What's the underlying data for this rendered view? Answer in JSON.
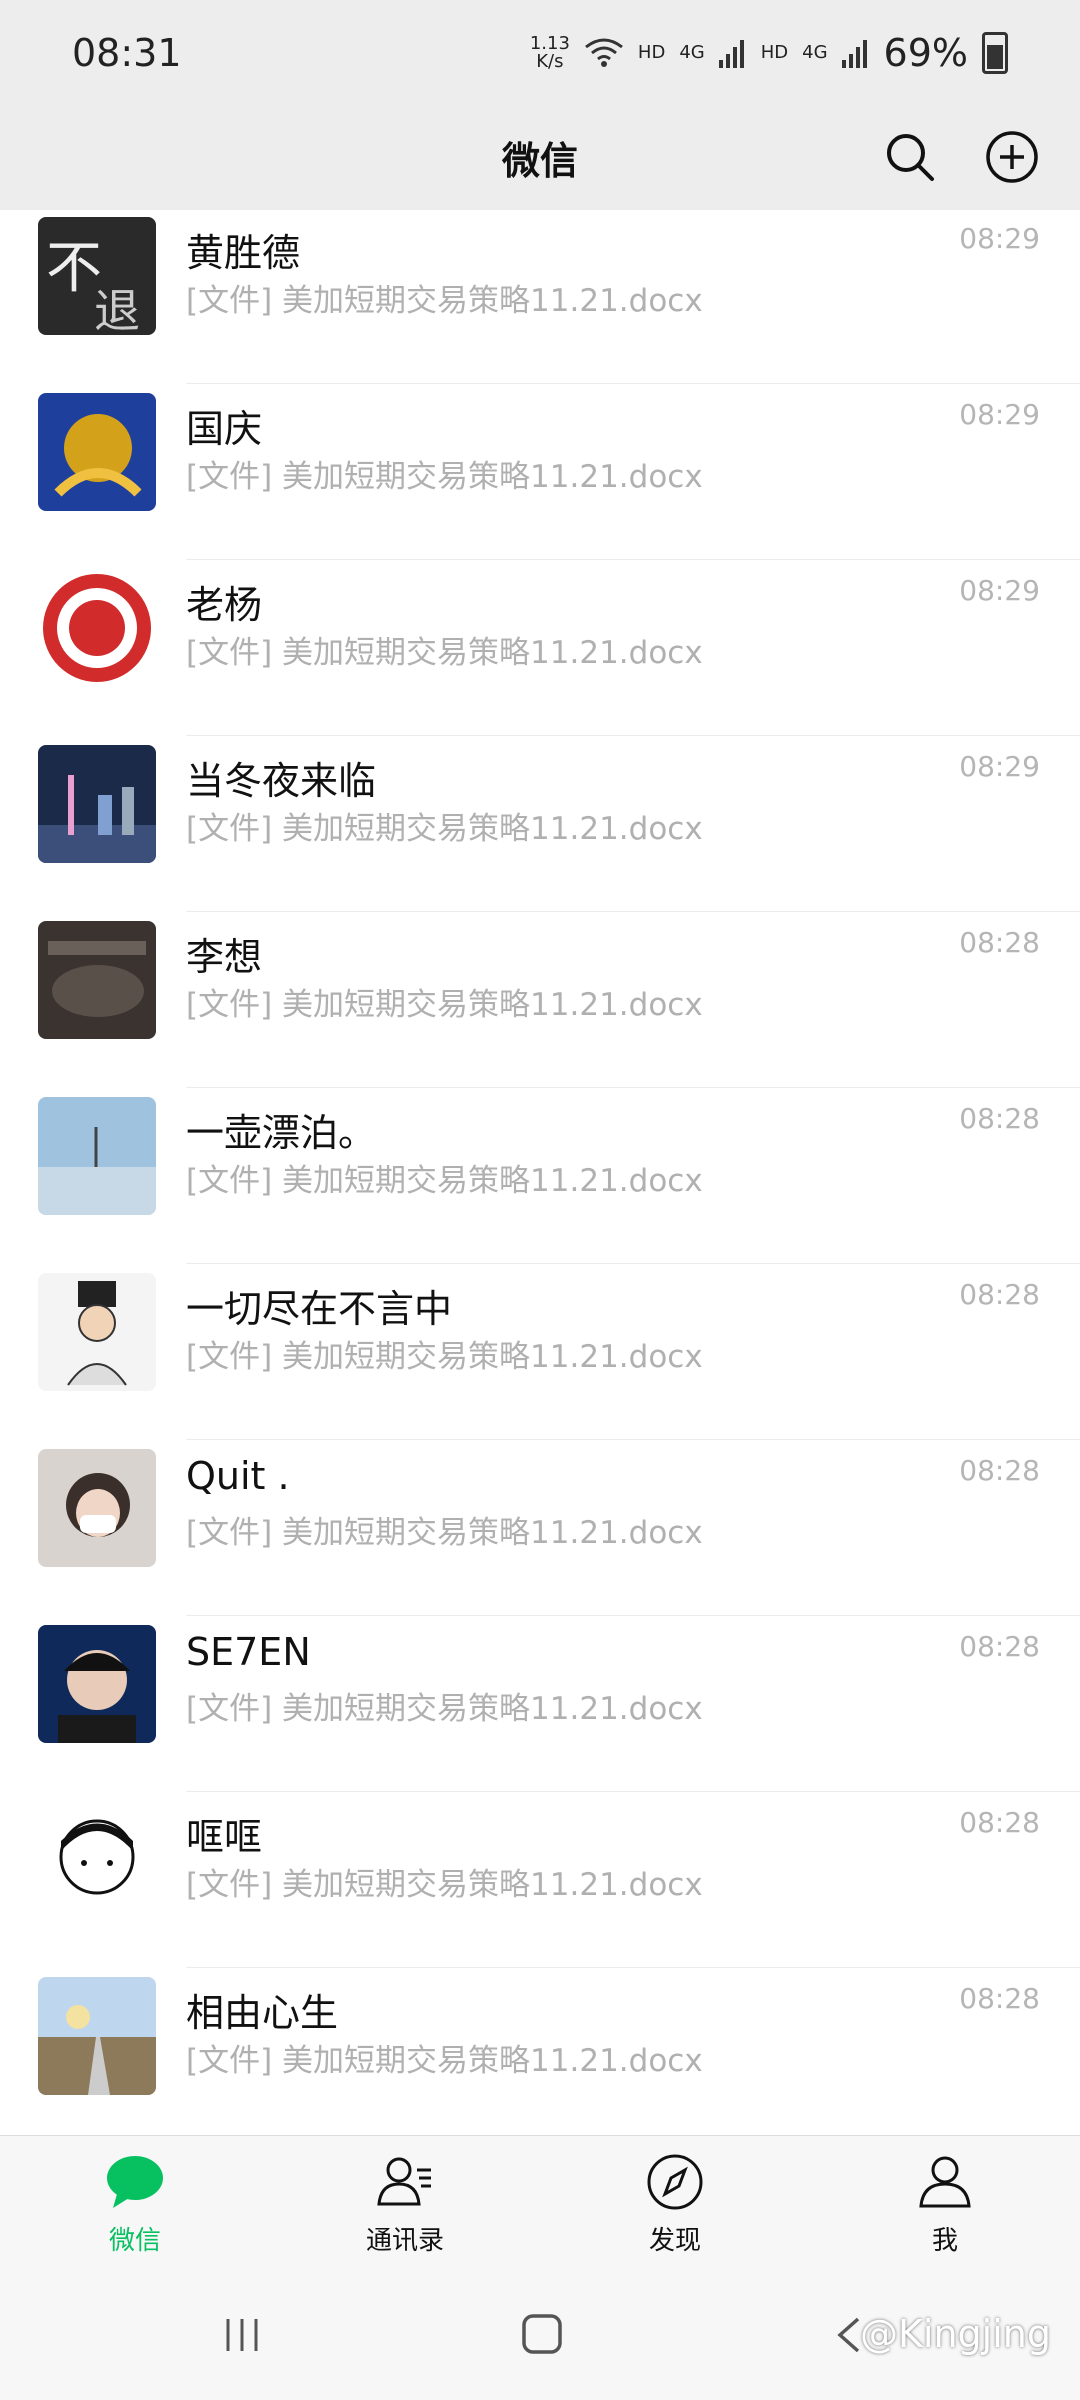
{
  "status_bar": {
    "time": "08:31",
    "net_speed_value": "1.13",
    "net_speed_unit": "K/s",
    "hd1": "HD",
    "net1": "4G",
    "hd2": "HD",
    "net2": "4G",
    "battery": "69%"
  },
  "header": {
    "title": "微信",
    "search_icon": "search-icon",
    "add_icon": "plus-circle-icon"
  },
  "chats": [
    {
      "name": "黄胜德",
      "preview": "[文件] 美加短期交易策略11.21.docx",
      "time": "08:29"
    },
    {
      "name": "国庆",
      "preview": "[文件] 美加短期交易策略11.21.docx",
      "time": "08:29"
    },
    {
      "name": "老杨",
      "preview": "[文件] 美加短期交易策略11.21.docx",
      "time": "08:29"
    },
    {
      "name": "当冬夜来临",
      "preview": "[文件] 美加短期交易策略11.21.docx",
      "time": "08:29"
    },
    {
      "name": "李想",
      "preview": "[文件] 美加短期交易策略11.21.docx",
      "time": "08:28"
    },
    {
      "name": "一壶漂泊。",
      "preview": "[文件] 美加短期交易策略11.21.docx",
      "time": "08:28"
    },
    {
      "name": "一切尽在不言中",
      "preview": "[文件] 美加短期交易策略11.21.docx",
      "time": "08:28"
    },
    {
      "name": "Quit .",
      "preview": "[文件] 美加短期交易策略11.21.docx",
      "time": "08:28"
    },
    {
      "name": "SE7EN",
      "preview": "[文件] 美加短期交易策略11.21.docx",
      "time": "08:28"
    },
    {
      "name": "哐哐",
      "preview": "[文件] 美加短期交易策略11.21.docx",
      "time": "08:28"
    },
    {
      "name": "相由心生",
      "preview": "[文件] 美加短期交易策略11.21.docx",
      "time": "08:28"
    }
  ],
  "tabs": [
    {
      "label": "微信",
      "icon": "chat-bubble-icon",
      "active": true
    },
    {
      "label": "通讯录",
      "icon": "contacts-icon",
      "active": false
    },
    {
      "label": "发现",
      "icon": "compass-icon",
      "active": false
    },
    {
      "label": "我",
      "icon": "person-icon",
      "active": false
    }
  ],
  "watermark": "@Kingjing",
  "colors": {
    "accent": "#07c160",
    "header_bg": "#ededed",
    "muted_text": "#b0b0b0"
  }
}
